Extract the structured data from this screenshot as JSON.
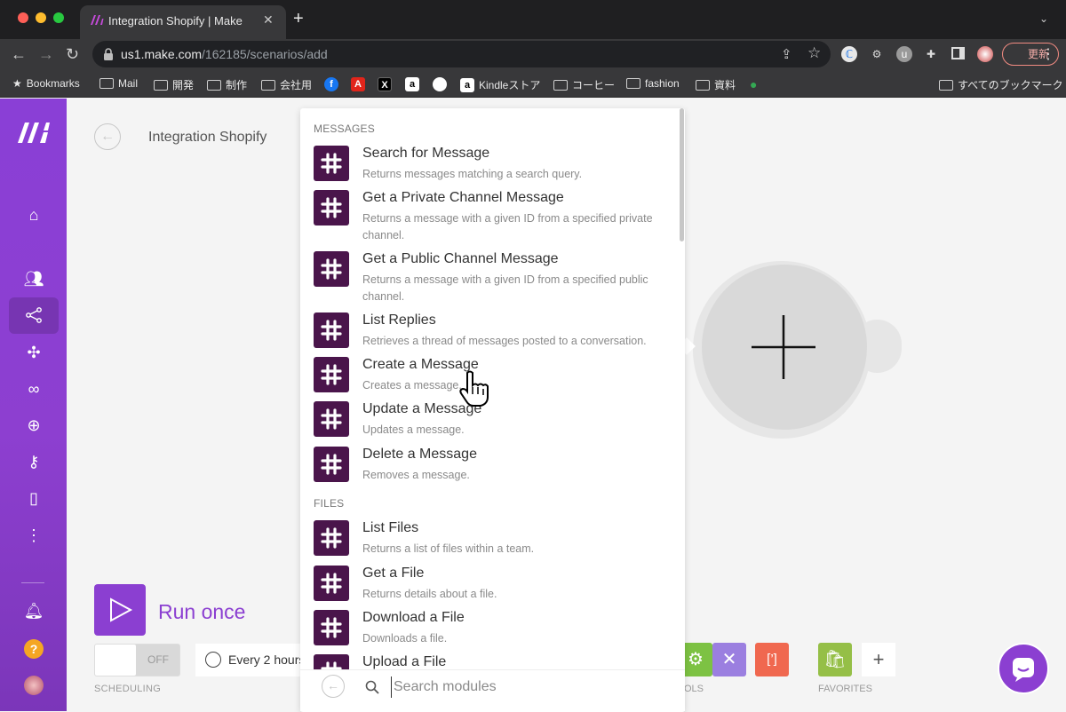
{
  "browser": {
    "tab_title": "Integration Shopify | Make",
    "url_host": "us1.make.com",
    "url_path": "/162185/scenarios/add",
    "update_label": "更新",
    "bookmarks_label": "Bookmarks",
    "bookmarks": [
      "Mail",
      "開発",
      "制作",
      "会社用",
      "Kindleストア",
      "コーヒー",
      "fashion",
      "資料"
    ],
    "all_bookmarks": "すべてのブックマーク"
  },
  "scenario": {
    "title": "Integration Shopify",
    "run_once": "Run once",
    "toggle_state": "OFF",
    "scheduling_label": "SCHEDULING",
    "schedule_text": "Every 2 hours",
    "tools_label": "OLS",
    "favorites_label": "FAVORITES"
  },
  "module_picker": {
    "sections": [
      {
        "label": "MESSAGES",
        "items": [
          {
            "title": "Search for Message",
            "desc": "Returns messages matching a search query."
          },
          {
            "title": "Get a Private Channel Message",
            "desc": "Returns a message with a given ID from a specified private channel."
          },
          {
            "title": "Get a Public Channel Message",
            "desc": "Returns a message with a given ID from a specified public channel."
          },
          {
            "title": "List Replies",
            "desc": "Retrieves a thread of messages posted to a conversation."
          },
          {
            "title": "Create a Message",
            "desc": "Creates a message."
          },
          {
            "title": "Update a Message",
            "desc": "Updates a message."
          },
          {
            "title": "Delete a Message",
            "desc": "Removes a message."
          }
        ]
      },
      {
        "label": "FILES",
        "items": [
          {
            "title": "List Files",
            "desc": "Returns a list of files within a team."
          },
          {
            "title": "Get a File",
            "desc": "Returns details about a file."
          },
          {
            "title": "Download a File",
            "desc": "Downloads a file."
          },
          {
            "title": "Upload a File",
            "desc": ""
          }
        ]
      }
    ],
    "search_placeholder": "Search modules"
  },
  "colors": {
    "brand_purple": "#8b3fd1",
    "slack_aubergine": "#4a154b",
    "tools_green": "#7dc243",
    "tools_purple": "#9b7fe0",
    "tools_orange": "#f0684f",
    "shopify_green": "#95bf47"
  }
}
